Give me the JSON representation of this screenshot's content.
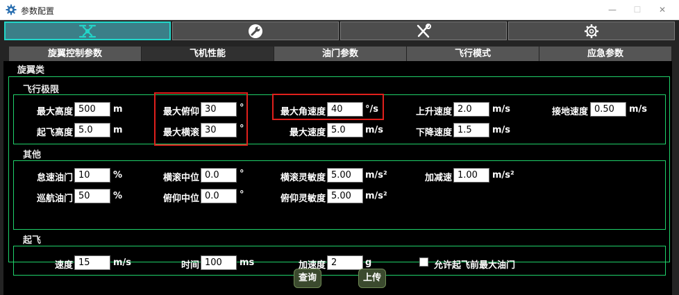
{
  "window": {
    "title": "参数配置",
    "minimize": "—",
    "maximize": "☐",
    "close": "✕"
  },
  "icon_tabs": [
    {
      "icon": "drone-icon",
      "active": true
    },
    {
      "icon": "wrench-circle-icon",
      "active": false
    },
    {
      "icon": "tools-icon",
      "active": false
    },
    {
      "icon": "gear-icon",
      "active": false
    }
  ],
  "sub_tabs": [
    "旋翼控制参数",
    "飞机性能",
    "油门参数",
    "飞行模式",
    "应急参数"
  ],
  "active_sub_tab": "飞机性能",
  "group_title": "旋翼类",
  "flight_limits": {
    "title": "飞行极限",
    "max_height": {
      "label": "最大高度",
      "value": "500",
      "unit": "m"
    },
    "takeoff_height": {
      "label": "起飞高度",
      "value": "5.0",
      "unit": "m"
    },
    "max_pitch": {
      "label": "最大俯仰",
      "value": "30",
      "unit": "°"
    },
    "max_roll": {
      "label": "最大横滚",
      "value": "30",
      "unit": "°"
    },
    "max_angular_speed": {
      "label": "最大角速度",
      "value": "40",
      "unit": "°/s"
    },
    "max_speed": {
      "label": "最大速度",
      "value": "5.0",
      "unit": "m/s"
    },
    "climb_speed": {
      "label": "上升速度",
      "value": "2.0",
      "unit": "m/s"
    },
    "descent_speed": {
      "label": "下降速度",
      "value": "1.5",
      "unit": "m/s"
    },
    "landing_speed": {
      "label": "接地速度",
      "value": "0.50",
      "unit": "m/s"
    }
  },
  "other": {
    "title": "其他",
    "idle_throttle": {
      "label": "怠速油门",
      "value": "10",
      "unit": "%"
    },
    "cruise_throttle": {
      "label": "巡航油门",
      "value": "50",
      "unit": "%"
    },
    "roll_center": {
      "label": "横滚中位",
      "value": "0.0",
      "unit": "°"
    },
    "pitch_center": {
      "label": "俯仰中位",
      "value": "0.0",
      "unit": "°"
    },
    "roll_sensitivity": {
      "label": "横滚灵敏度",
      "value": "5.00",
      "unit": "m/s²"
    },
    "pitch_sensitivity": {
      "label": "俯仰灵敏度",
      "value": "5.00",
      "unit": "m/s²"
    },
    "accel_decel": {
      "label": "加减速",
      "value": "1.00",
      "unit": "m/s²"
    }
  },
  "takeoff": {
    "title": "起飞",
    "speed": {
      "label": "速度",
      "value": "15",
      "unit": "m/s"
    },
    "time": {
      "label": "时间",
      "value": "100",
      "unit": "ms"
    },
    "acceleration": {
      "label": "加速度",
      "value": "2",
      "unit": "g"
    },
    "allow_max_throttle": {
      "label": "允许起飞前最大油门",
      "checked": false
    }
  },
  "buttons": {
    "query": "查询",
    "upload": "上传"
  },
  "colors": {
    "accent_border": "#1fd26a",
    "highlight": "#e0201c",
    "active_icon_tab": "#3b7f88"
  }
}
